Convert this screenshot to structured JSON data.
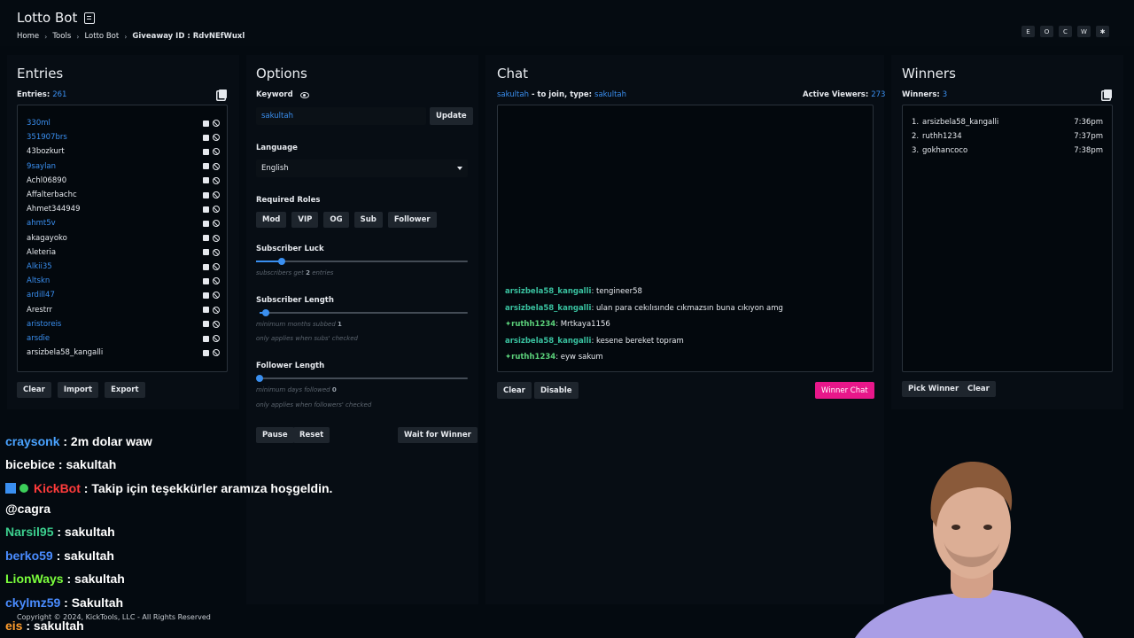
{
  "header": {
    "app_title": "Lotto Bot",
    "breadcrumb": [
      "Home",
      "Tools",
      "Lotto Bot"
    ],
    "giveaway_label": "Giveaway ID : RdvNEfWuxl",
    "top_buttons": [
      "E",
      "O",
      "C",
      "W",
      "✱"
    ]
  },
  "entries": {
    "title": "Entries",
    "count_label": "Entries:",
    "count": "261",
    "items": [
      {
        "name": "330ml",
        "color": "blue"
      },
      {
        "name": "351907brs",
        "color": "blue"
      },
      {
        "name": "43bozkurt",
        "color": "white"
      },
      {
        "name": "9saylan",
        "color": "blue"
      },
      {
        "name": "Achl06890",
        "color": "white"
      },
      {
        "name": "Affalterbachc",
        "color": "white"
      },
      {
        "name": "Ahmet344949",
        "color": "white"
      },
      {
        "name": "ahmt5v",
        "color": "blue"
      },
      {
        "name": "akagayoko",
        "color": "white"
      },
      {
        "name": "Aleteria",
        "color": "white"
      },
      {
        "name": "Alkii35",
        "color": "blue"
      },
      {
        "name": "Altskn",
        "color": "blue"
      },
      {
        "name": "ardill47",
        "color": "blue"
      },
      {
        "name": "Arestrr",
        "color": "white"
      },
      {
        "name": "aristoreis",
        "color": "blue"
      },
      {
        "name": "arsdie",
        "color": "blue"
      },
      {
        "name": "arsizbela58_kangalli",
        "color": "white"
      }
    ],
    "buttons": {
      "clear": "Clear",
      "import": "Import",
      "export": "Export"
    }
  },
  "options": {
    "title": "Options",
    "keyword_label": "Keyword",
    "keyword_value": "sakultah",
    "update_button": "Update",
    "language_label": "Language",
    "language_value": "English",
    "roles_label": "Required Roles",
    "roles": [
      "Mod",
      "VIP",
      "OG",
      "Sub",
      "Follower"
    ],
    "sub_luck_label": "Subscriber Luck",
    "sub_luck_hint_pre": "subscribers get",
    "sub_luck_hint_val": "2",
    "sub_luck_hint_post": "entries",
    "sub_luck_value": 0.12,
    "sub_length_label": "Subscriber Length",
    "sub_length_hint_pre": "minimum months subbed",
    "sub_length_hint_val": "1",
    "sub_length_hint2": "only applies when subs' checked",
    "sub_length_value": 0.03,
    "follower_length_label": "Follower Length",
    "follower_length_hint_pre": "minimum days followed",
    "follower_length_hint_val": "0",
    "follower_length_hint2": "only applies when followers' checked",
    "follower_length_value": 0.0,
    "pause_button": "Pause",
    "reset_button": "Reset",
    "wait_button": "Wait for Winner"
  },
  "chat": {
    "title": "Chat",
    "join_user": "sakultah",
    "join_text": " - to join, type: ",
    "join_keyword": "sakultah",
    "viewers_label": "Active Viewers:",
    "viewers": "273",
    "messages": [
      {
        "user": "arsizbela58_kangalli",
        "text": "tengineer58",
        "badge": false
      },
      {
        "user": "arsizbela58_kangalli",
        "text": "ulan para cekılısınde cıkmazsın buna cıkıyon amg",
        "badge": false
      },
      {
        "user": "ruthh1234",
        "text": "Mrtkaya1156",
        "badge": true
      },
      {
        "user": "arsizbela58_kangalli",
        "text": "kesene bereket topram",
        "badge": false
      },
      {
        "user": "ruthh1234",
        "text": "eyw sakum",
        "badge": true
      }
    ],
    "clear_button": "Clear",
    "disable_button": "Disable",
    "winner_chat_button": "Winner Chat",
    "accent": "#e8178a"
  },
  "winners": {
    "title": "Winners",
    "count_label": "Winners:",
    "count": "3",
    "items": [
      {
        "index": "1.",
        "name": "arsizbela58_kangalli",
        "time": "7:36pm"
      },
      {
        "index": "2.",
        "name": "ruthh1234",
        "time": "7:37pm"
      },
      {
        "index": "3.",
        "name": "gokhancoco",
        "time": "7:38pm"
      }
    ],
    "pick_button": "Pick Winner",
    "clear_button": "Clear"
  },
  "stream_chat": [
    {
      "user": "craysonk",
      "text": " : 2m dolar waw",
      "color": "#4aa3ff"
    },
    {
      "user": "bicebice",
      "text": " : sakultah",
      "color": "#ffffff"
    },
    {
      "user": "KickBot",
      "text": " : Takip için teşekkürler aramıza hoşgeldin.",
      "color": "#ff3b3b"
    },
    {
      "user": "",
      "text": "@cagra",
      "color": "#ffffff"
    },
    {
      "user": "Narsil95",
      "text": " : sakultah",
      "color": "#3ccf8e"
    },
    {
      "user": "berko59",
      "text": " : sakultah",
      "color": "#4a8cff"
    },
    {
      "user": "LionWays",
      "text": " : sakultah",
      "color": "#7bff3c"
    },
    {
      "user": "ckylmz59",
      "text": " : Sakultah",
      "color": "#4a8cff"
    },
    {
      "user": "eis",
      "text": " : sakultah",
      "color": "#ff9d2e"
    }
  ],
  "footer": "Copyright © 2024, KickTools, LLC - All Rights Reserved"
}
